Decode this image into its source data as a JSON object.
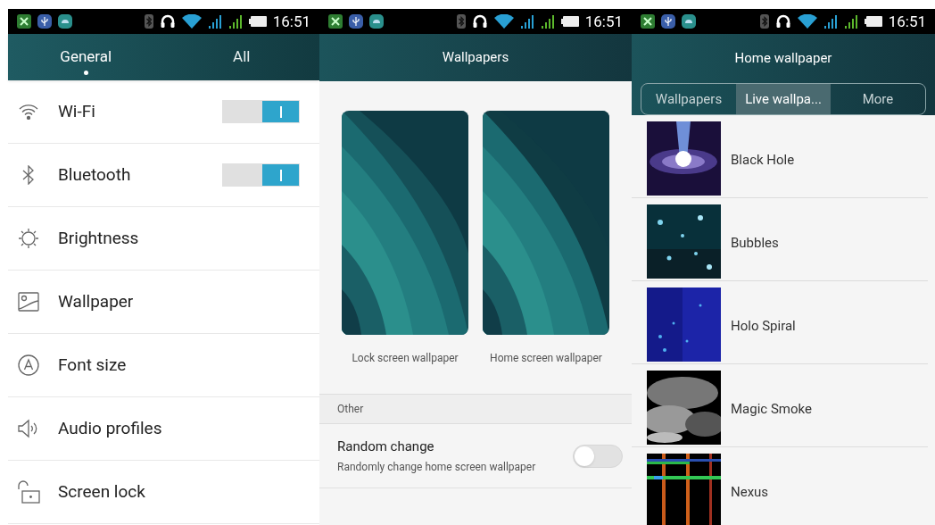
{
  "panels": [
    {
      "kind": "settings",
      "status_bar": {
        "time": "16:51"
      },
      "tabs": [
        {
          "label": "General",
          "selected": true
        },
        {
          "label": "All",
          "selected": false
        }
      ],
      "items": [
        {
          "label": "Wi-Fi",
          "kind": "toggle",
          "on": true
        },
        {
          "label": "Bluetooth",
          "kind": "toggle",
          "on": true
        },
        {
          "label": "Brightness",
          "kind": "link"
        },
        {
          "label": "Wallpaper",
          "kind": "link"
        },
        {
          "label": "Font size",
          "kind": "link"
        },
        {
          "label": "Audio profiles",
          "kind": "link"
        },
        {
          "label": "Screen lock",
          "kind": "link"
        }
      ]
    },
    {
      "kind": "wallpapers",
      "status_bar": {
        "time": "16:51"
      },
      "title": "Wallpapers",
      "previews": [
        {
          "label": "Lock screen wallpaper"
        },
        {
          "label": "Home screen wallpaper"
        }
      ],
      "section": "Other",
      "setting": {
        "title": "Random change",
        "subtitle": "Randomly change home screen wallpaper",
        "on": false
      }
    },
    {
      "kind": "live",
      "status_bar": {
        "time": "16:51"
      },
      "title": "Home wallpaper",
      "tabs": [
        {
          "label": "Wallpapers",
          "selected": false
        },
        {
          "label": "Live wallpa...",
          "selected": true
        },
        {
          "label": "More",
          "selected": false
        }
      ],
      "items": [
        {
          "label": "Black Hole"
        },
        {
          "label": "Bubbles"
        },
        {
          "label": "Holo Spiral"
        },
        {
          "label": "Magic Smoke"
        },
        {
          "label": "Nexus"
        }
      ]
    }
  ]
}
